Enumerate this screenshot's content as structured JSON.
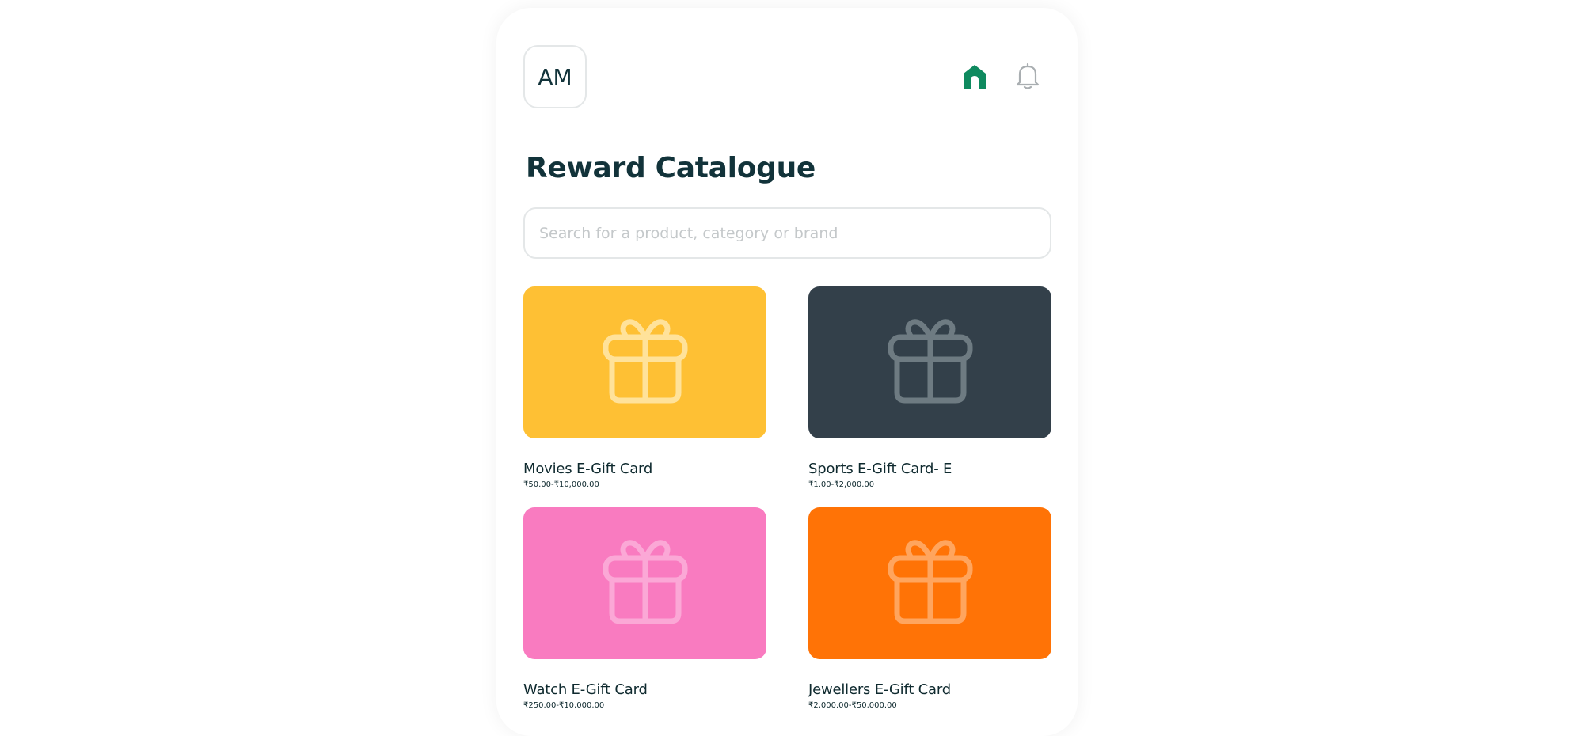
{
  "header": {
    "avatar_initials": "AM",
    "home_icon": "home-icon",
    "bell_icon": "bell-icon"
  },
  "page": {
    "title": "Reward Catalogue"
  },
  "search": {
    "placeholder": "Search for a product, category or brand",
    "value": ""
  },
  "colors": {
    "accent": "#0f8a5f",
    "title": "#12333a",
    "border": "#e4e7e8"
  },
  "cards": [
    {
      "name": "Movies E-Gift Card",
      "price": "₹50.00-₹10,000.00",
      "bg": "#fec034",
      "icon_color": "#ffe29a",
      "icon": "gift-icon"
    },
    {
      "name": "Sports E-Gift Card- E",
      "price": "₹1.00-₹2,000.00",
      "bg": "#33404a",
      "icon_color": "#6e7b82",
      "icon": "gift-icon"
    },
    {
      "name": "Watch E-Gift Card",
      "price": "₹250.00-₹10,000.00",
      "bg": "#f97bc0",
      "icon_color": "#fba8d6",
      "icon": "gift-icon"
    },
    {
      "name": "Jewellers E-Gift Card",
      "price": "₹2,000.00-₹50,000.00",
      "bg": "#ff7306",
      "icon_color": "#ffa55e",
      "icon": "gift-icon"
    }
  ]
}
